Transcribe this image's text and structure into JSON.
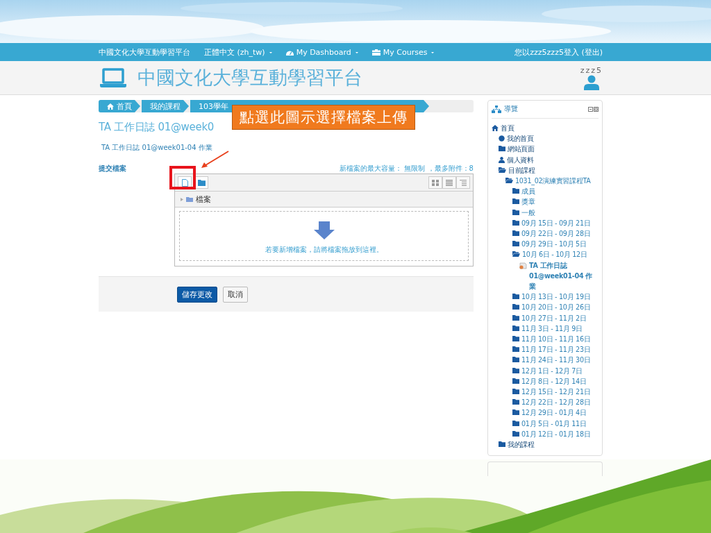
{
  "slide": {
    "callout": "點選此圖示選擇檔案上傳"
  },
  "navbar": {
    "site": "中國文化大學互動學習平台",
    "menus": [
      {
        "label": "正體中文 (zh_tw)",
        "kind": "language"
      },
      {
        "label": "My Dashboard",
        "kind": "dashboard"
      },
      {
        "label": "My Courses",
        "kind": "courses"
      }
    ],
    "login": "您以zzz5zzz5登入 (登出)"
  },
  "header": {
    "title": "中國文化大學互動學習平台",
    "user": "zzz5"
  },
  "breadcrumb": [
    {
      "label": "首頁",
      "kind": "home"
    },
    {
      "label": "我的課程",
      "kind": "link"
    },
    {
      "label": "103學年",
      "kind": "link"
    }
  ],
  "page_title": "TA 工作日誌 01@week0",
  "description": "TA 工作日誌 01@week01-04 作業",
  "submission": {
    "label": "提交檔案",
    "limits": "新檔案的最大容量： 無限制 ，最多附件：8",
    "folder": "檔案",
    "drop_hint": "若要新增檔案，請將檔案拖放到這裡。"
  },
  "buttons": [
    {
      "label": "儲存更改",
      "kind": "primary"
    },
    {
      "label": "取消",
      "kind": "secondary"
    }
  ],
  "navigation": {
    "title": "導覽",
    "items": [
      {
        "label": "首頁",
        "kind": "home",
        "children": [
          {
            "label": "我的首頁",
            "kind": "dot"
          },
          {
            "label": "網站頁面",
            "kind": "folder"
          },
          {
            "label": "個人資料",
            "kind": "person"
          },
          {
            "label": "目前課程",
            "kind": "open",
            "children": [
              {
                "label": "1031_02演練實習課程TA",
                "kind": "open",
                "children": [
                  {
                    "label": "成員",
                    "kind": "folder"
                  },
                  {
                    "label": "獎章",
                    "kind": "folder"
                  },
                  {
                    "label": "一般",
                    "kind": "folder"
                  },
                  {
                    "label": "09月 15日 - 09月 21日",
                    "kind": "folder"
                  },
                  {
                    "label": "09月 22日 - 09月 28日",
                    "kind": "folder"
                  },
                  {
                    "label": "09月 29日 - 10月 5日",
                    "kind": "folder"
                  },
                  {
                    "label": "10月 6日 - 10月 12日",
                    "kind": "open",
                    "children": [
                      {
                        "label": "TA 工作日誌 01@week01-04 作業",
                        "kind": "assignment"
                      }
                    ]
                  },
                  {
                    "label": "10月 13日 - 10月 19日",
                    "kind": "folder"
                  },
                  {
                    "label": "10月 20日 - 10月 26日",
                    "kind": "folder"
                  },
                  {
                    "label": "10月 27日 - 11月 2日",
                    "kind": "folder"
                  },
                  {
                    "label": "11月 3日 - 11月 9日",
                    "kind": "folder"
                  },
                  {
                    "label": "11月 10日 - 11月 16日",
                    "kind": "folder"
                  },
                  {
                    "label": "11月 17日 - 11月 23日",
                    "kind": "folder"
                  },
                  {
                    "label": "11月 24日 - 11月 30日",
                    "kind": "folder"
                  },
                  {
                    "label": "12月 1日 - 12月 7日",
                    "kind": "folder"
                  },
                  {
                    "label": "12月 8日 - 12月 14日",
                    "kind": "folder"
                  },
                  {
                    "label": "12月 15日 - 12月 21日",
                    "kind": "folder"
                  },
                  {
                    "label": "12月 22日 - 12月 28日",
                    "kind": "folder"
                  },
                  {
                    "label": "12月 29日 - 01月 4日",
                    "kind": "folder"
                  },
                  {
                    "label": "01月 5日 - 01月 11日",
                    "kind": "folder"
                  },
                  {
                    "label": "01月 12日 - 01月 18日",
                    "kind": "folder"
                  }
                ]
              }
            ]
          },
          {
            "label": "我的課程",
            "kind": "folder"
          }
        ]
      }
    ]
  }
}
